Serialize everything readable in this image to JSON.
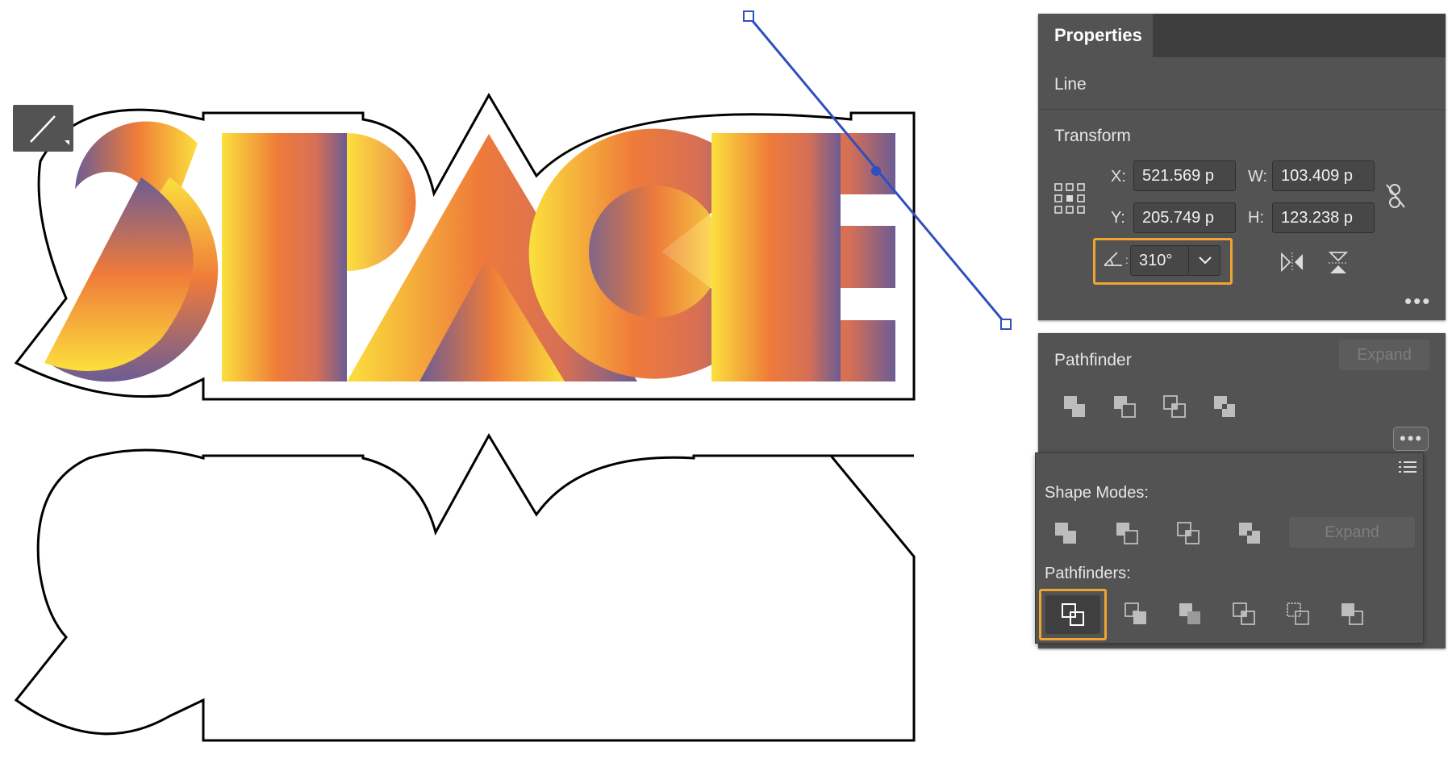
{
  "artwork": {
    "title_text": "SPACE",
    "gradient_colors": [
      "#fbe03c",
      "#f3a04a",
      "#ef7b3a",
      "#d66f55",
      "#6c5c94"
    ]
  },
  "properties_panel": {
    "tab_label": "Properties",
    "object_type": "Line",
    "transform": {
      "section_label": "Transform",
      "x_label": "X:",
      "x_value": "521.569 p",
      "y_label": "Y:",
      "y_value": "205.749 p",
      "w_label": "W:",
      "w_value": "103.409 p",
      "h_label": "H:",
      "h_value": "123.238 p",
      "angle_value": "310°",
      "icons": [
        "reference-point-icon",
        "angle-icon",
        "chevron-down-icon",
        "link-constrain-icon",
        "flip-horizontal-icon",
        "flip-vertical-icon",
        "more-options-icon"
      ]
    }
  },
  "pathfinder_panel": {
    "section_label": "Pathfinder",
    "expand_label": "Expand",
    "icons": [
      "unite-icon",
      "minus-front-icon",
      "intersect-icon",
      "exclude-icon",
      "more-options-icon"
    ]
  },
  "flyout": {
    "shape_modes_label": "Shape Modes:",
    "pathfinders_label": "Pathfinders:",
    "expand_label": "Expand",
    "icons": [
      "panel-menu-icon",
      "unite-icon",
      "minus-front-icon",
      "intersect-icon",
      "exclude-icon",
      "divide-icon",
      "trim-icon",
      "merge-icon",
      "crop-icon",
      "outline-icon",
      "minus-back-icon"
    ]
  },
  "accent_color": "#f0a531",
  "selection_color": "#2f4fbf"
}
